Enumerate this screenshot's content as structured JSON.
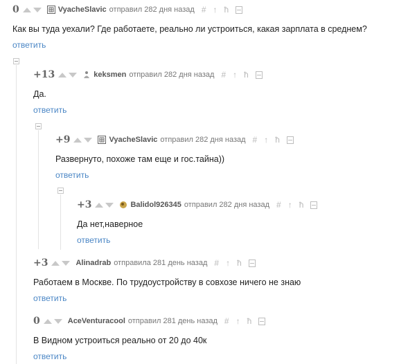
{
  "actions": {
    "reply_label": "ответить"
  },
  "icons": {
    "hash": "#",
    "arrow_up": "↑",
    "branch": "ħ"
  },
  "comments": [
    {
      "rating": "0",
      "author": "VyacheSlavic",
      "meta": "отправил 282 дня назад",
      "text": "Как вы туда уехали? Где работаете, реально ли устроиться, какая зарплата в среднем?",
      "avatar_icon": "grid-avatar-icon"
    },
    {
      "rating": "+13",
      "author": "keksmen",
      "meta": "отправил 282 дня назад",
      "text": "Да.",
      "avatar_icon": "figure-avatar-icon"
    },
    {
      "rating": "+9",
      "author": "VyacheSlavic",
      "meta": "отправил 282 дня назад",
      "text": "Развернуто, похоже там еще и гос.тайна))",
      "avatar_icon": "grid-avatar-icon"
    },
    {
      "rating": "+3",
      "author": "Balidol926345",
      "meta": "отправил 282 дня назад",
      "text": "Да нет,наверное",
      "avatar_icon": "pill-avatar-icon"
    },
    {
      "rating": "+3",
      "author": "Alinadrab",
      "meta": "отправила 281 день назад",
      "text": "Работаем в Москве. По трудоустройству в совхозе ничего не знаю",
      "avatar_icon": ""
    },
    {
      "rating": "0",
      "author": "AceVenturacool",
      "meta": "отправил 281 день назад",
      "text": "В Видном устроиться реально от 20 до 40к",
      "avatar_icon": ""
    }
  ]
}
